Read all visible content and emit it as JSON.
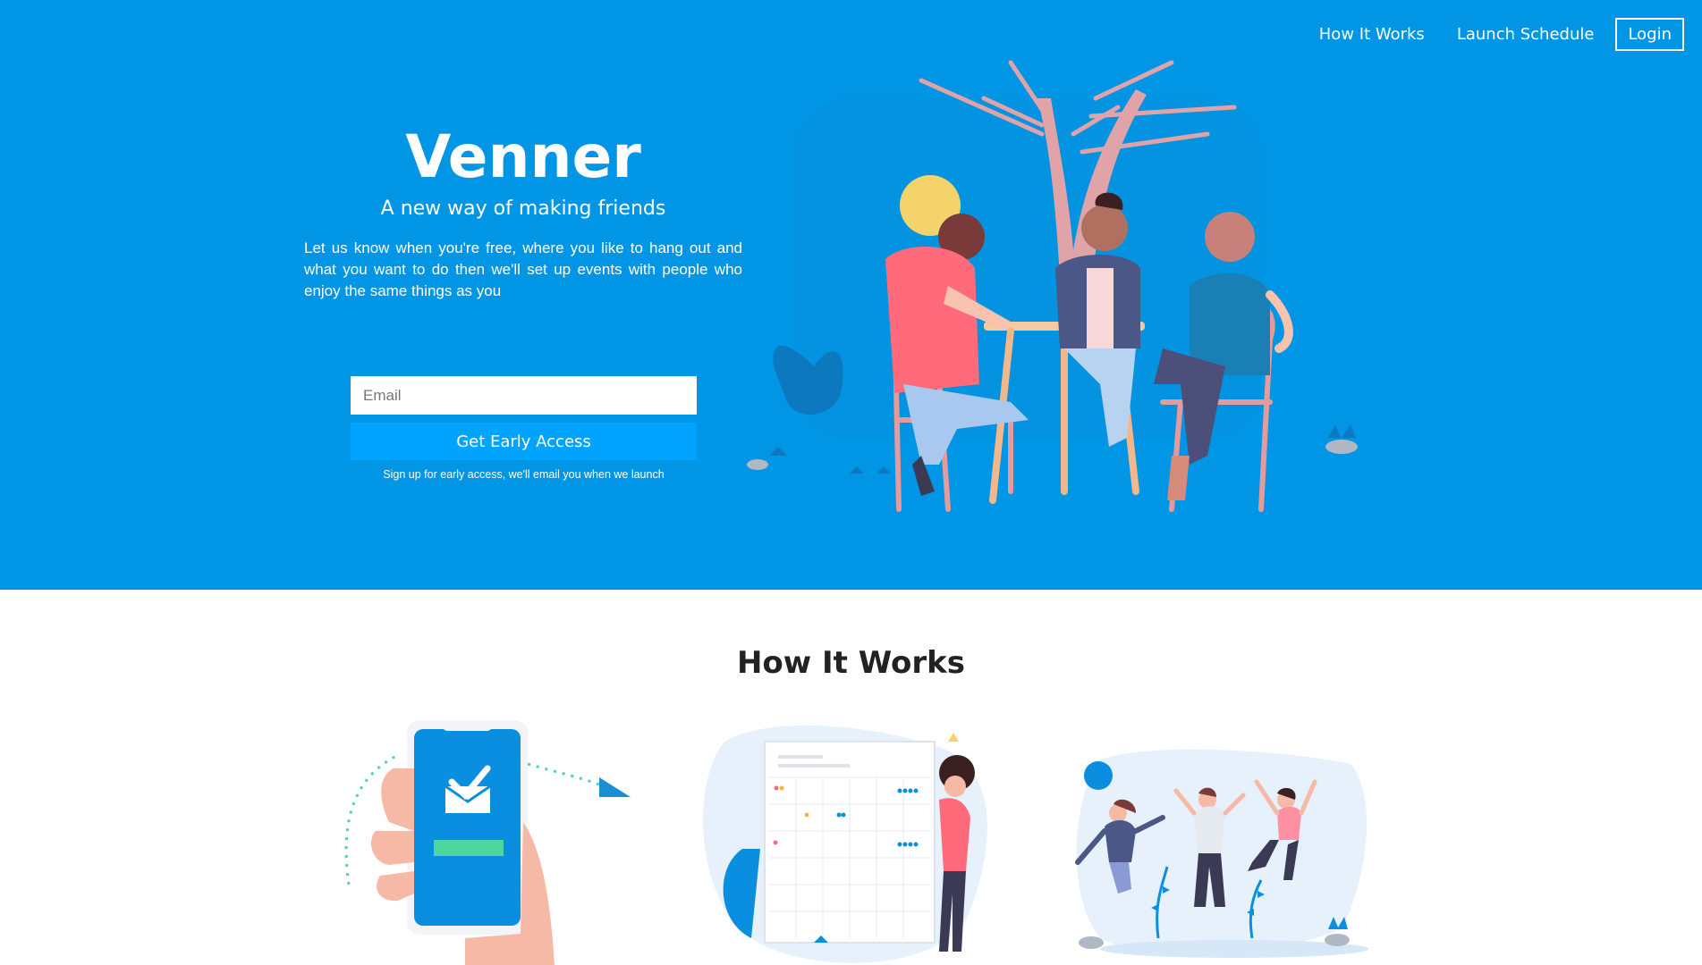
{
  "nav": {
    "how_it_works": "How It Works",
    "launch_schedule": "Launch Schedule",
    "login": "Login"
  },
  "hero": {
    "brand": "Venner",
    "tagline": "A new way of making friends",
    "description": "Let us know when you're free, where you like to hang out and what you want to do then we'll set up events with people who enjoy the same things as you",
    "email_placeholder": "Email",
    "cta_label": "Get Early Access",
    "hint": "Sign up for early access, we'll email you when we launch"
  },
  "how_it_works": {
    "title": "How It Works"
  },
  "colors": {
    "hero_bg": "#0095e5",
    "cta_bg": "#00a4ff",
    "accent_green": "#4fd6a0"
  }
}
